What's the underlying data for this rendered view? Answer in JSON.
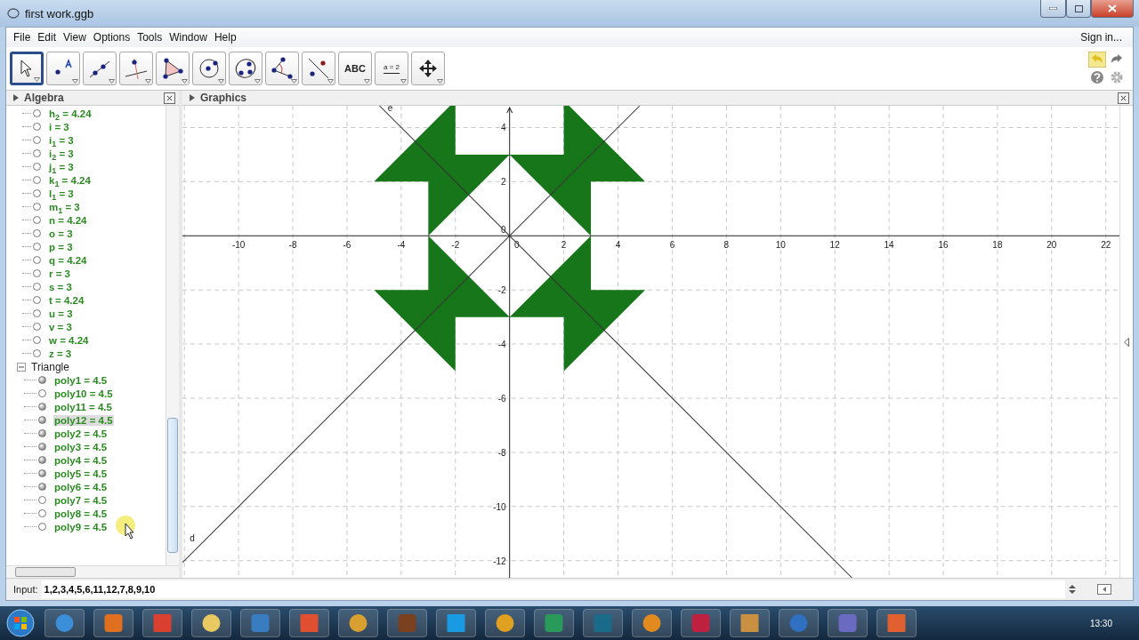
{
  "window": {
    "title": "first work.ggb"
  },
  "menu": [
    "File",
    "Edit",
    "View",
    "Options",
    "Tools",
    "Window",
    "Help"
  ],
  "sign_in": "Sign in...",
  "tools": [
    {
      "kind": "move",
      "selected": true
    },
    {
      "kind": "point",
      "selected": false
    },
    {
      "kind": "line",
      "selected": false
    },
    {
      "kind": "perpendicular",
      "selected": false
    },
    {
      "kind": "polygon",
      "selected": false
    },
    {
      "kind": "circle",
      "selected": false
    },
    {
      "kind": "ellipse",
      "selected": false
    },
    {
      "kind": "angle",
      "selected": false
    },
    {
      "kind": "reflect",
      "selected": false
    },
    {
      "kind": "text",
      "label": "ABC",
      "selected": false
    },
    {
      "kind": "slider",
      "label": "a = 2",
      "selected": false
    },
    {
      "kind": "pan",
      "selected": false
    }
  ],
  "algebra": {
    "title": "Algebra",
    "items": [
      {
        "kind": "object",
        "text": "h$_{2}$ = 4.24",
        "visible": false,
        "selected": false
      },
      {
        "kind": "object",
        "text": "i = 3",
        "visible": false,
        "selected": false
      },
      {
        "kind": "object",
        "text": "i$_{1}$ = 3",
        "visible": false,
        "selected": false
      },
      {
        "kind": "object",
        "text": "i$_{2}$ = 3",
        "visible": false,
        "selected": false
      },
      {
        "kind": "object",
        "text": "j$_{1}$ = 3",
        "visible": false,
        "selected": false
      },
      {
        "kind": "object",
        "text": "k$_{1}$ = 4.24",
        "visible": false,
        "selected": false
      },
      {
        "kind": "object",
        "text": "l$_{1}$ = 3",
        "visible": false,
        "selected": false
      },
      {
        "kind": "object",
        "text": "m$_{1}$ = 3",
        "visible": false,
        "selected": false
      },
      {
        "kind": "object",
        "text": "n = 4.24",
        "visible": false,
        "selected": false
      },
      {
        "kind": "object",
        "text": "o = 3",
        "visible": false,
        "selected": false
      },
      {
        "kind": "object",
        "text": "p = 3",
        "visible": false,
        "selected": false
      },
      {
        "kind": "object",
        "text": "q = 4.24",
        "visible": false,
        "selected": false
      },
      {
        "kind": "object",
        "text": "r = 3",
        "visible": false,
        "selected": false
      },
      {
        "kind": "object",
        "text": "s = 3",
        "visible": false,
        "selected": false
      },
      {
        "kind": "object",
        "text": "t = 4.24",
        "visible": false,
        "selected": false
      },
      {
        "kind": "object",
        "text": "u = 3",
        "visible": false,
        "selected": false
      },
      {
        "kind": "object",
        "text": "v = 3",
        "visible": false,
        "selected": false
      },
      {
        "kind": "object",
        "text": "w = 4.24",
        "visible": false,
        "selected": false
      },
      {
        "kind": "object",
        "text": "z = 3",
        "visible": false,
        "selected": false
      },
      {
        "kind": "group",
        "label": "Triangle",
        "expanded": true,
        "children": [
          {
            "kind": "object",
            "text": "poly1 = 4.5",
            "visible": true,
            "selected": false
          },
          {
            "kind": "object",
            "text": "poly10 = 4.5",
            "visible": false,
            "selected": false
          },
          {
            "kind": "object",
            "text": "poly11 = 4.5",
            "visible": true,
            "selected": false
          },
          {
            "kind": "object",
            "text": "poly12 = 4.5",
            "visible": true,
            "selected": true
          },
          {
            "kind": "object",
            "text": "poly2 = 4.5",
            "visible": true,
            "selected": false
          },
          {
            "kind": "object",
            "text": "poly3 = 4.5",
            "visible": true,
            "selected": false
          },
          {
            "kind": "object",
            "text": "poly4 = 4.5",
            "visible": true,
            "selected": false
          },
          {
            "kind": "object",
            "text": "poly5 = 4.5",
            "visible": true,
            "selected": false
          },
          {
            "kind": "object",
            "text": "poly6 = 4.5",
            "visible": true,
            "selected": false
          },
          {
            "kind": "object",
            "text": "poly7 = 4.5",
            "visible": false,
            "selected": false
          },
          {
            "kind": "object",
            "text": "poly8 = 4.5",
            "visible": false,
            "selected": false
          },
          {
            "kind": "object",
            "text": "poly9 = 4.5",
            "visible": false,
            "selected": false
          }
        ]
      }
    ]
  },
  "graphics": {
    "title": "Graphics",
    "x_ticks": [
      "-10",
      "-8",
      "-6",
      "-4",
      "-2",
      "0",
      "2",
      "4",
      "6",
      "8",
      "10",
      "12",
      "14",
      "16",
      "18",
      "20",
      "22"
    ],
    "y_ticks": [
      "4",
      "2",
      "0",
      "-2",
      "-4",
      "-6",
      "-8",
      "-10",
      "-12"
    ],
    "lines": [
      {
        "kind": "falling",
        "label": "e"
      },
      {
        "kind": "rising",
        "label": "d"
      }
    ]
  },
  "input": {
    "label": "Input:",
    "value": "1,2,3,4,5,6,11,12,7,8,9,10"
  },
  "taskbar": {
    "clock": "13:30"
  }
}
